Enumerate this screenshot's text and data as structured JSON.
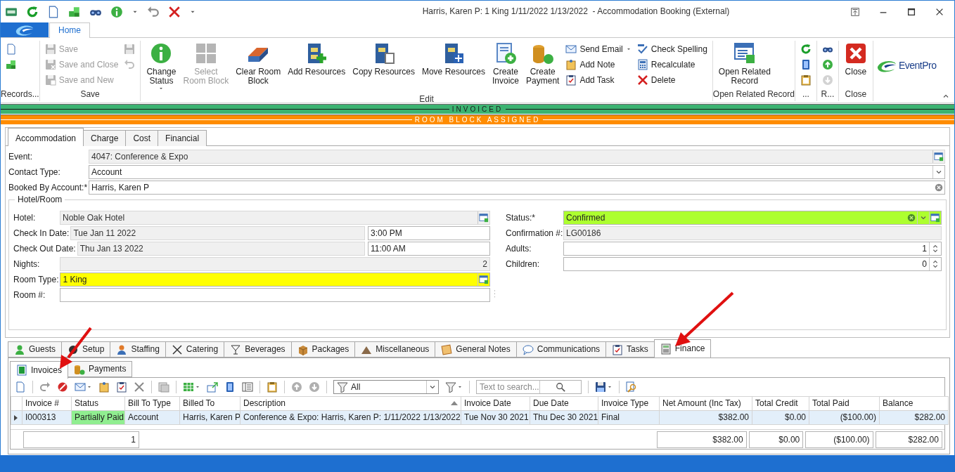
{
  "window": {
    "title": "Harris, Karen P: 1 King 1/11/2022 1/13/2022  - Accommodation Booking (External)"
  },
  "ribbon": {
    "tabs": [
      {
        "label": "Home",
        "selected": true
      }
    ],
    "groups": [
      {
        "label": "Records...",
        "items": [
          {
            "kind": "icon",
            "disabled": false
          },
          {
            "kind": "icon",
            "disabled": false
          }
        ]
      },
      {
        "label": "Save",
        "items": [
          {
            "kind": "small",
            "label": "Save",
            "disabled": true,
            "dropdown": false
          },
          {
            "kind": "small",
            "label": "Save and Close",
            "disabled": true,
            "dropdown": false
          },
          {
            "kind": "small",
            "label": "Save and New",
            "disabled": true,
            "dropdown": false
          },
          {
            "kind": "icon",
            "disabled": true
          },
          {
            "kind": "icon",
            "disabled": true
          }
        ]
      },
      {
        "label": "Edit",
        "items": [
          {
            "kind": "large",
            "label": "Change\nStatus",
            "disabled": false,
            "dropdown": true
          },
          {
            "kind": "large",
            "label": "Select\nRoom Block",
            "disabled": true,
            "dropdown": false
          },
          {
            "kind": "large",
            "label": "Clear Room\nBlock",
            "disabled": false,
            "dropdown": false
          },
          {
            "kind": "large",
            "label": "Add Resources",
            "disabled": false,
            "dropdown": false
          },
          {
            "kind": "large",
            "label": "Copy Resources",
            "disabled": false,
            "dropdown": false
          },
          {
            "kind": "large",
            "label": "Move Resources",
            "disabled": false,
            "dropdown": false
          },
          {
            "kind": "large",
            "label": "Create\nInvoice",
            "disabled": false,
            "dropdown": false
          },
          {
            "kind": "large",
            "label": "Create\nPayment",
            "disabled": false,
            "dropdown": false
          },
          {
            "kind": "small",
            "label": "Send Email",
            "disabled": false,
            "dropdown": true
          },
          {
            "kind": "small",
            "label": "Add Note",
            "disabled": false,
            "dropdown": false
          },
          {
            "kind": "small",
            "label": "Add Task",
            "disabled": false,
            "dropdown": false
          },
          {
            "kind": "small",
            "label": "Check Spelling",
            "disabled": false,
            "dropdown": false
          },
          {
            "kind": "small",
            "label": "Recalculate",
            "disabled": false,
            "dropdown": false
          },
          {
            "kind": "small",
            "label": "Delete",
            "disabled": false,
            "dropdown": false
          }
        ]
      },
      {
        "label": "Open Related Record",
        "items": [
          {
            "kind": "large",
            "label": "Open Related\nRecord",
            "disabled": false,
            "dropdown": false
          }
        ]
      },
      {
        "label": "...",
        "items": [
          {
            "kind": "icon",
            "disabled": false
          },
          {
            "kind": "icon",
            "disabled": false
          },
          {
            "kind": "icon",
            "disabled": false
          }
        ]
      },
      {
        "label": "R...",
        "items": [
          {
            "kind": "icon",
            "disabled": false
          },
          {
            "kind": "icon",
            "disabled": false
          },
          {
            "kind": "icon",
            "disabled": true
          }
        ]
      },
      {
        "label": "Close",
        "items": [
          {
            "kind": "large",
            "label": "Close",
            "disabled": false,
            "dropdown": false
          }
        ]
      }
    ],
    "logo": "EventPro"
  },
  "status_bands": [
    {
      "label": "INVOICED",
      "color": "#3cb371"
    },
    {
      "label": "ROOM BLOCK ASSIGNED",
      "color": "#ff8c00"
    }
  ],
  "record_tabs": [
    {
      "label": "Accommodation",
      "selected": true
    },
    {
      "label": "Charge",
      "selected": false
    },
    {
      "label": "Cost",
      "selected": false
    },
    {
      "label": "Financial",
      "selected": false
    }
  ],
  "fields": [
    {
      "label": "Event:",
      "value": "4047: Conference & Expo",
      "readonly": true,
      "kind": "lookup"
    },
    {
      "label": "Contact Type:",
      "value": "Account",
      "readonly": false,
      "kind": "dropdown"
    },
    {
      "label": "Booked By Account:*",
      "value": "Harris, Karen P",
      "readonly": false,
      "kind": "clearable"
    }
  ],
  "hotel_room": {
    "legend": "Hotel/Room",
    "left": [
      {
        "label": "Hotel:",
        "value": "Noble Oak Hotel",
        "readonly": true,
        "kind": "lookup"
      },
      {
        "label": "Check In Date:",
        "value": "Tue Jan 11 2022",
        "time": "3:00 PM",
        "readonly": true,
        "kind": "datetime"
      },
      {
        "label": "Check Out Date:",
        "value": "Thu Jan 13 2022",
        "time": "11:00 AM",
        "readonly": true,
        "kind": "datetime"
      },
      {
        "label": "Nights:",
        "value": "2",
        "readonly": true,
        "kind": "number"
      },
      {
        "label": "Room Type:",
        "value": "1 King",
        "readonly": false,
        "kind": "lookup",
        "color": "#ffff00"
      },
      {
        "label": "Room #:",
        "readonly": false,
        "kind": "text"
      }
    ],
    "right": [
      {
        "label": "Status:*",
        "value": "Confirmed",
        "readonly": false,
        "kind": "status",
        "color": "#adff2f"
      },
      {
        "label": "Confirmation #:",
        "value": "LG00186",
        "readonly": true,
        "kind": "text"
      },
      {
        "label": "Adults:",
        "value": "1",
        "readonly": false,
        "kind": "spin"
      },
      {
        "label": "Children:",
        "value": "0",
        "readonly": false,
        "kind": "spin"
      }
    ]
  },
  "section_tabs": [
    {
      "label": "Guests",
      "selected": false
    },
    {
      "label": "Setup",
      "selected": false
    },
    {
      "label": "Staffing",
      "selected": false
    },
    {
      "label": "Catering",
      "selected": false
    },
    {
      "label": "Beverages",
      "selected": false
    },
    {
      "label": "Packages",
      "selected": false
    },
    {
      "label": "Miscellaneous",
      "selected": false
    },
    {
      "label": "General Notes",
      "selected": false
    },
    {
      "label": "Communications",
      "selected": false
    },
    {
      "label": "Tasks",
      "selected": false
    },
    {
      "label": "Finance",
      "selected": true
    }
  ],
  "finance_tabs": [
    {
      "label": "Invoices",
      "selected": true
    },
    {
      "label": "Payments",
      "selected": false
    }
  ],
  "toolbar": {
    "filter": "All",
    "search": {
      "placeholder": "Text to search..."
    }
  },
  "invoices": {
    "columns": [
      {
        "label": "Invoice #",
        "sorted": false
      },
      {
        "label": "Status",
        "sorted": false
      },
      {
        "label": "Bill To Type",
        "sorted": false
      },
      {
        "label": "Billed To",
        "sorted": false
      },
      {
        "label": "Description",
        "sorted": true
      },
      {
        "label": "Invoice Date",
        "sorted": false
      },
      {
        "label": "Due Date",
        "sorted": false
      },
      {
        "label": "Invoice Type",
        "sorted": false
      },
      {
        "label": "Net Amount (Inc Tax)",
        "sorted": false
      },
      {
        "label": "Total Credit",
        "sorted": false
      },
      {
        "label": "Total Paid",
        "sorted": false
      },
      {
        "label": "Balance",
        "sorted": false
      }
    ],
    "rows": [
      {
        "selected": true,
        "color": "#90ee90",
        "cells": [
          "I000313",
          "Partially Paid",
          "Account",
          "Harris, Karen P",
          "Conference & Expo: Harris, Karen P: 1/11/2022 1/13/2022",
          "Tue Nov 30 2021",
          "Thu Dec 30 2021",
          "Final",
          "$382.00",
          "$0.00",
          "($100.00)",
          "$282.00"
        ]
      }
    ],
    "footer": {
      "count": "1",
      "totals": [
        "$382.00",
        "$0.00",
        "($100.00)",
        "$282.00"
      ]
    }
  }
}
